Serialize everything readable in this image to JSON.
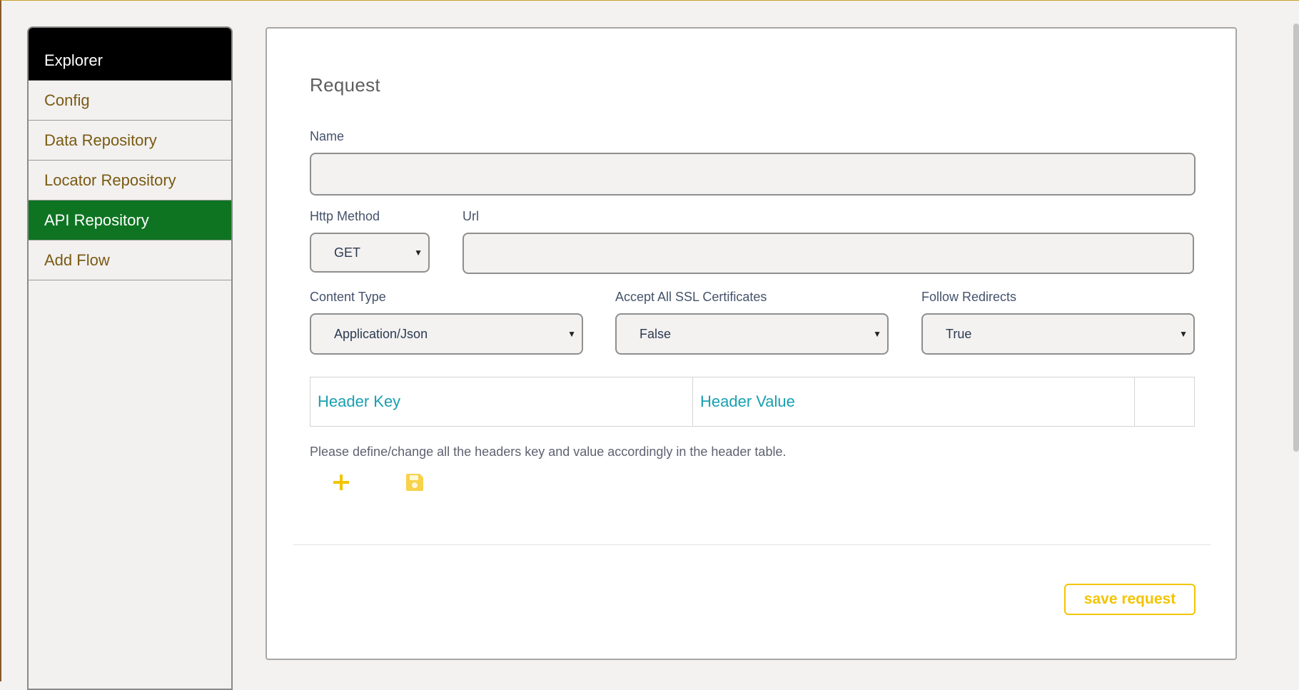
{
  "sidebar": {
    "items": [
      {
        "label": "Explorer"
      },
      {
        "label": "Config"
      },
      {
        "label": "Data Repository"
      },
      {
        "label": "Locator Repository"
      },
      {
        "label": "API Repository"
      },
      {
        "label": "Add Flow"
      }
    ],
    "active_index": 4
  },
  "form": {
    "title": "Request",
    "name": {
      "label": "Name",
      "value": ""
    },
    "http_method": {
      "label": "Http Method",
      "value": "GET"
    },
    "url": {
      "label": "Url",
      "value": ""
    },
    "content_type": {
      "label": "Content Type",
      "value": "Application/Json"
    },
    "ssl": {
      "label": "Accept All SSL Certificates",
      "value": "False"
    },
    "redirects": {
      "label": "Follow Redirects",
      "value": "True"
    }
  },
  "headers_table": {
    "columns": [
      "Header Key",
      "Header Value"
    ]
  },
  "help_text": "Please define/change all the headers key and value accordingly in the header table.",
  "actions": {
    "add_icon": "plus-icon",
    "save_icon": "floppy-disk-icon",
    "save_request_label": "save request"
  },
  "colors": {
    "active_nav": "#0e7422",
    "explorer_bg": "#000000",
    "accent_yellow": "#f3c400",
    "table_header_text": "#18a0b0",
    "nav_text": "#7a5a12"
  }
}
